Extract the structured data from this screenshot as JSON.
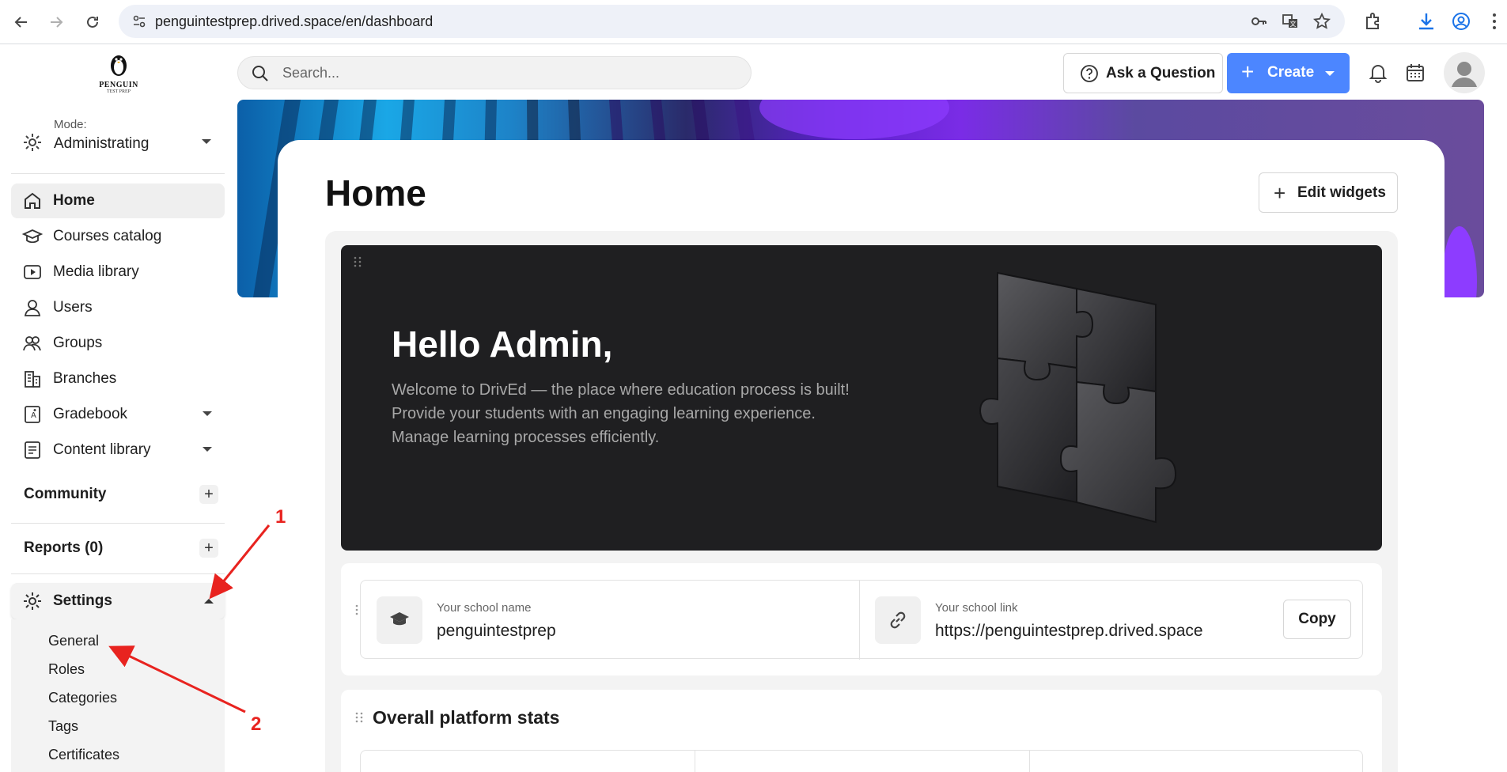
{
  "browser": {
    "url": "penguintestprep.drived.space/en/dashboard"
  },
  "logo": {
    "name": "PENGUIN",
    "sub": "TEST PREP"
  },
  "mode": {
    "label": "Mode:",
    "value": "Administrating"
  },
  "sidebar": {
    "items": [
      {
        "label": "Home",
        "icon": "home-icon"
      },
      {
        "label": "Courses catalog",
        "icon": "graduation-cap-icon"
      },
      {
        "label": "Media library",
        "icon": "video-icon"
      },
      {
        "label": "Users",
        "icon": "user-icon"
      },
      {
        "label": "Groups",
        "icon": "users-icon"
      },
      {
        "label": "Branches",
        "icon": "building-icon"
      },
      {
        "label": "Gradebook",
        "icon": "gradebook-icon"
      },
      {
        "label": "Content library",
        "icon": "document-icon"
      }
    ],
    "community": "Community",
    "reports": "Reports (0)",
    "settings": "Settings",
    "settings_items": [
      "General",
      "Roles",
      "Categories",
      "Tags",
      "Certificates"
    ]
  },
  "topbar": {
    "search_placeholder": "Search...",
    "ask_label": "Ask a Question",
    "create_label": "Create"
  },
  "main": {
    "title": "Home",
    "edit_widgets": "Edit widgets",
    "hello_title": "Hello Admin,",
    "hello_lines": [
      "Welcome to DrivEd — the place where education process is built!",
      "Provide your students with an engaging learning experience.",
      "Manage learning processes efficiently."
    ],
    "school_name_label": "Your school name",
    "school_name": "penguintestprep",
    "school_link_label": "Your school link",
    "school_link": "https://penguintestprep.drived.space",
    "copy_label": "Copy",
    "stats_title": "Overall platform stats"
  },
  "annotations": {
    "one": "1",
    "two": "2"
  },
  "colors": {
    "accent": "#4c86ff",
    "annotation": "#e8231f",
    "hero_bg": "#1f1f21"
  }
}
